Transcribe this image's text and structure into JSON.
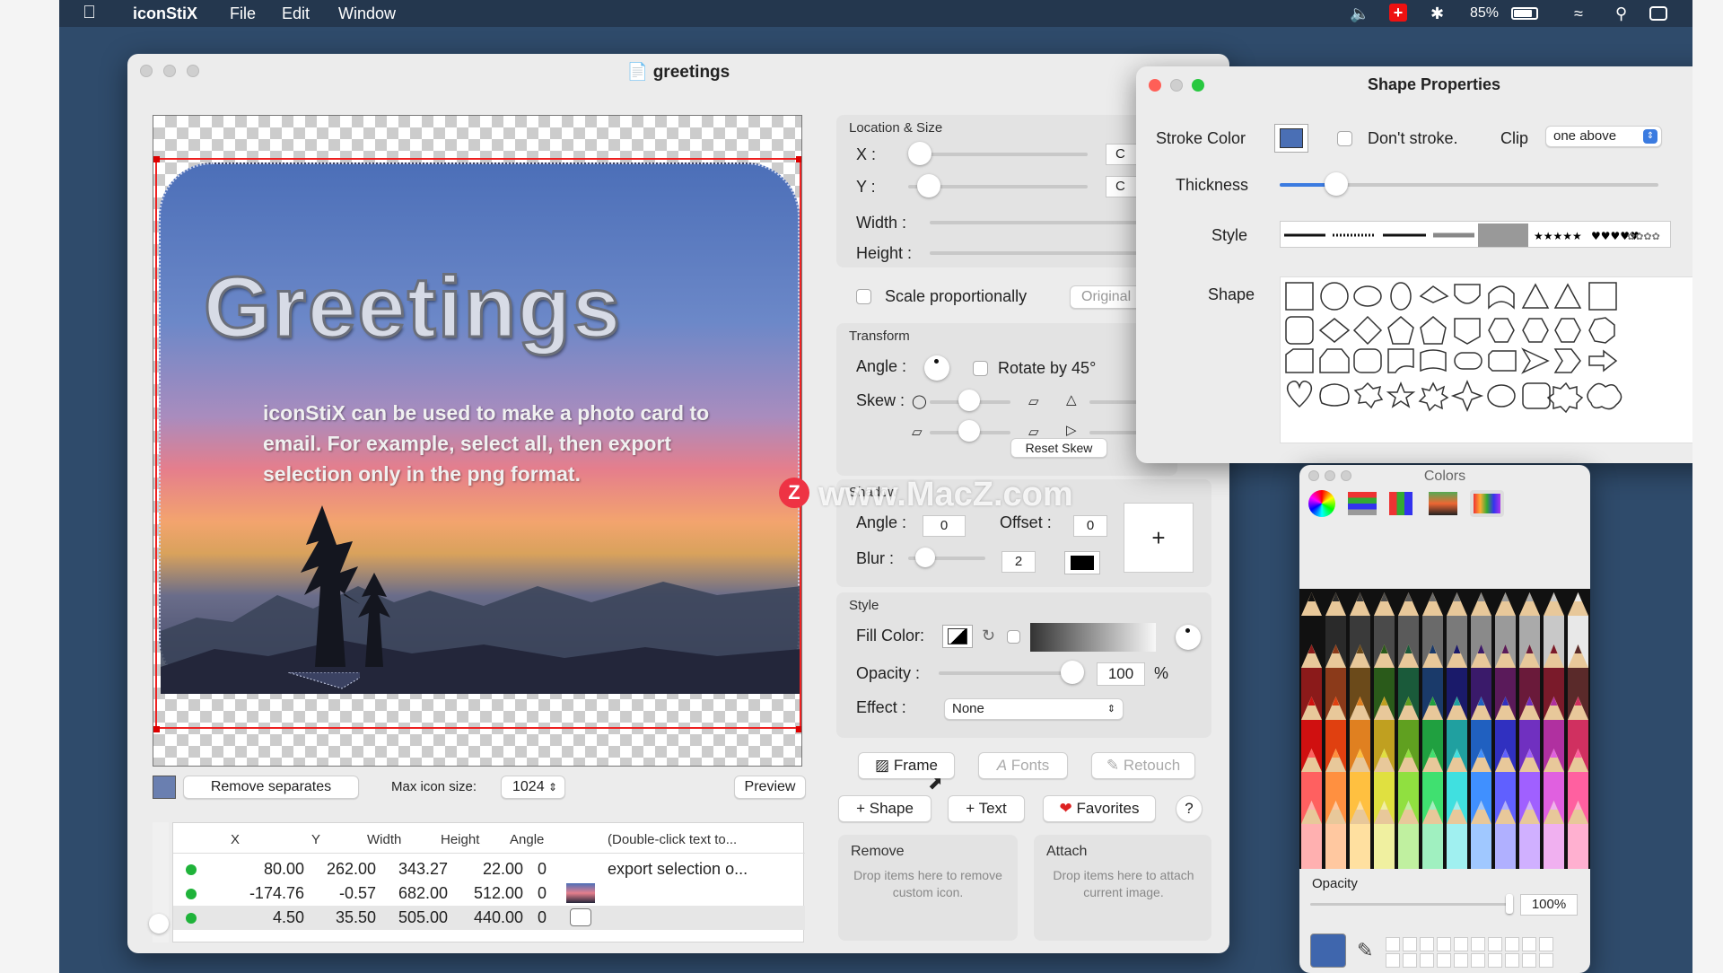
{
  "menubar": {
    "app": "iconStiX",
    "menus": [
      "File",
      "Edit",
      "Window"
    ],
    "battery": "85%"
  },
  "main_window": {
    "title": "greetings",
    "card": {
      "heading": "Greetings",
      "body": "iconStiX can be used to make a photo card to email.  For example, select all, then export selection only in the png format."
    },
    "bottom_bar": {
      "remove_separates": "Remove separates",
      "max_icon_size_label": "Max icon size:",
      "max_icon_size_value": "1024",
      "preview": "Preview"
    },
    "table": {
      "headers": [
        "X",
        "Y",
        "Width",
        "Height",
        "Angle",
        "(Double-click text to..."
      ],
      "rows": [
        {
          "x": "80.00",
          "y": "262.00",
          "w": "343.27",
          "h": "22.00",
          "a": "0",
          "text": "export selection o..."
        },
        {
          "x": "-174.76",
          "y": "-0.57",
          "w": "682.00",
          "h": "512.00",
          "a": "0",
          "text": ""
        },
        {
          "x": "4.50",
          "y": "35.50",
          "w": "505.00",
          "h": "440.00",
          "a": "0",
          "text": ""
        }
      ]
    },
    "location_size": {
      "title": "Location & Size",
      "x_label": "X :",
      "y_label": "Y :",
      "width_label": "Width :",
      "height_label": "Height :",
      "x_value": "C",
      "y_value": "C",
      "scale": "Scale proportionally",
      "original": "Original I"
    },
    "transform": {
      "title": "Transform",
      "angle_label": "Angle :",
      "rotate45": "Rotate by 45°",
      "skew_label": "Skew :",
      "reset": "Reset Skew"
    },
    "shadow": {
      "title": "Shadow",
      "angle_label": "Angle :",
      "angle_value": "0",
      "offset_label": "Offset :",
      "offset_value": "0",
      "blur_label": "Blur :",
      "blur_value": "2",
      "plus": "+"
    },
    "style": {
      "title": "Style",
      "fill_label": "Fill Color:",
      "opacity_label": "Opacity :",
      "opacity_value": "100",
      "percent": "%",
      "effect_label": "Effect :",
      "effect_value": "None",
      "frame": "Frame",
      "fonts": "Fonts",
      "retouch": "Retouch"
    },
    "actions": {
      "shape": "+ Shape",
      "text": "+ Text",
      "favorites": "Favorites",
      "help": "?"
    },
    "remove_box": {
      "title": "Remove",
      "hint": "Drop items here to remove custom icon."
    },
    "attach_box": {
      "title": "Attach",
      "hint": "Drop items here to attach current image."
    }
  },
  "shape_properties": {
    "title": "Shape Properties",
    "stroke_color_label": "Stroke Color",
    "dont_stroke": "Don't stroke.",
    "clip_label": "Clip",
    "clip_value": "one above",
    "thickness_label": "Thickness",
    "thickness_fraction": 0.15,
    "style_label": "Style",
    "shape_label": "Shape",
    "stroke_color": "#4a6fb5"
  },
  "colors_panel": {
    "title": "Colors",
    "opacity_label": "Opacity",
    "opacity_value": "100%",
    "current_color": "#3f66ad"
  },
  "watermark": "www.MacZ.com",
  "watermark_badge": "Z"
}
